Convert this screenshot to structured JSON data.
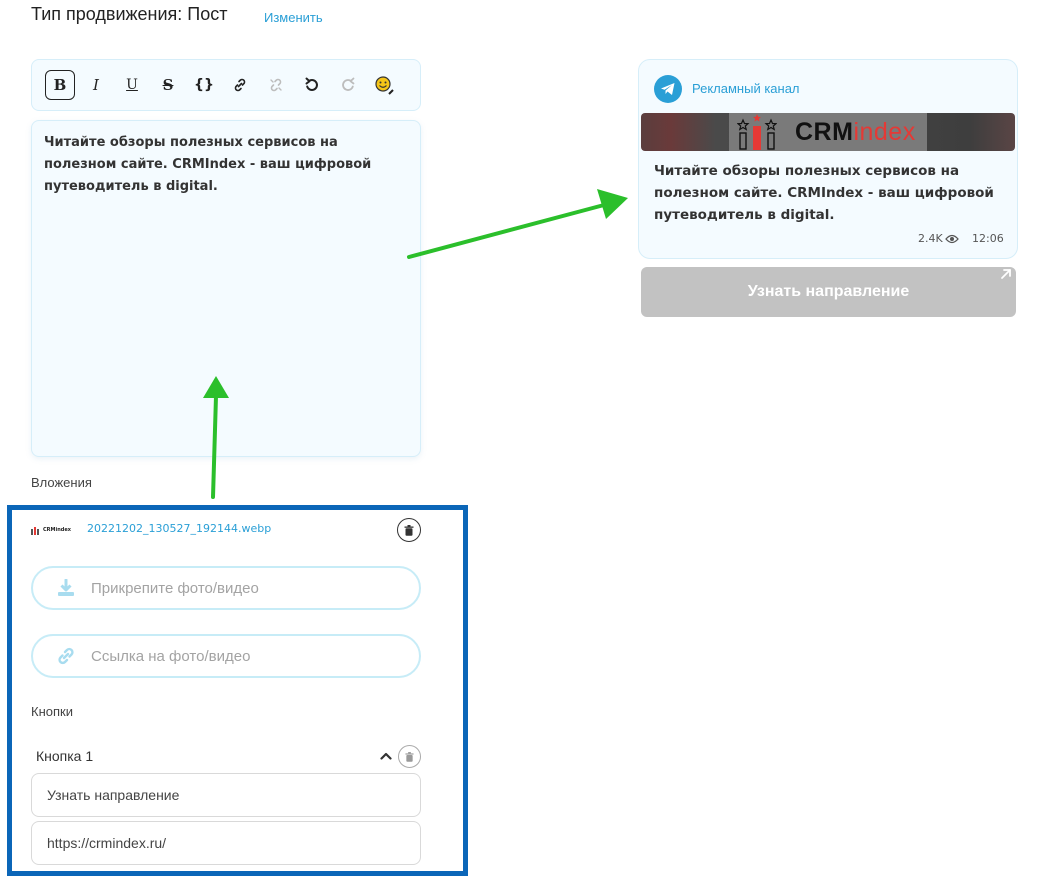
{
  "header": {
    "title": "Тип продвижения: Пост",
    "change_link": "Изменить"
  },
  "toolbar": {
    "buttons": [
      {
        "label": "B",
        "icon": "bold-icon"
      },
      {
        "label": "I",
        "icon": "italic-icon"
      },
      {
        "label": "U",
        "icon": "underline-icon"
      },
      {
        "label": "S",
        "icon": "strikethrough-icon"
      },
      {
        "label": "{}",
        "icon": "code-icon"
      },
      {
        "label": "",
        "icon": "link-icon"
      },
      {
        "label": "",
        "icon": "unlink-icon"
      },
      {
        "label": "",
        "icon": "undo-icon"
      },
      {
        "label": "",
        "icon": "redo-icon"
      },
      {
        "label": "",
        "icon": "emoji-icon"
      }
    ]
  },
  "editor": {
    "text": "Читайте обзоры полезных сервисов на полезном сайте. CRMIndex - ваш цифровой путеводитель в digital."
  },
  "attachments": {
    "label": "Вложения",
    "file": {
      "thumbnail_text": "CRMindex",
      "name": "20221202_130527_192144.webp"
    },
    "upload_placeholder": "Прикрепите фото/видео",
    "link_placeholder": "Ссылка на фото/видео"
  },
  "buttons_section": {
    "label": "Кнопки",
    "items": [
      {
        "title": "Кнопка 1",
        "name_value": "Узнать направление",
        "url_value": "https://crmindex.ru/"
      }
    ]
  },
  "preview": {
    "channel_name": "Рекламный канал",
    "banner": {
      "logo_main": "CRM",
      "logo_accent": "index"
    },
    "text": "Читайте обзоры полезных сервисов на полезном сайте. CRMIndex - ваш цифровой путеводитель в digital.",
    "views": "2.4K",
    "time": "12:06",
    "button_label": "Узнать направление"
  },
  "colors": {
    "accent": "#2a9fd6",
    "highlight_border": "#0b66b8",
    "arrow": "#2bbf2b",
    "preview_button": "#c2c2c2"
  }
}
